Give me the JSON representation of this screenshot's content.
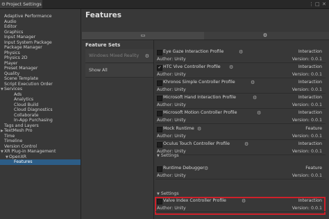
{
  "window": {
    "tab_label": "Project Settings",
    "icons": [
      "gear-icon",
      "more-icon",
      "maximize-icon",
      "close-icon"
    ],
    "controls": [
      "⋮",
      "□",
      "✕"
    ]
  },
  "sidebar": {
    "items": [
      {
        "label": "Adaptive Performance",
        "indent": 0
      },
      {
        "label": "Audio",
        "indent": 0
      },
      {
        "label": "Editor",
        "indent": 0
      },
      {
        "label": "Graphics",
        "indent": 0
      },
      {
        "label": "Input Manager",
        "indent": 0
      },
      {
        "label": "Input System Package",
        "indent": 0
      },
      {
        "label": "Package Manager",
        "indent": 0
      },
      {
        "label": "Physics",
        "indent": 0
      },
      {
        "label": "Physics 2D",
        "indent": 0
      },
      {
        "label": "Player",
        "indent": 0
      },
      {
        "label": "Preset Manager",
        "indent": 0
      },
      {
        "label": "Quality",
        "indent": 0
      },
      {
        "label": "Scene Template",
        "indent": 0
      },
      {
        "label": "Script Execution Order",
        "indent": 0
      },
      {
        "label": "Services",
        "indent": 0,
        "expanded": true
      },
      {
        "label": "Ads",
        "indent": 2
      },
      {
        "label": "Analytics",
        "indent": 2
      },
      {
        "label": "Cloud Build",
        "indent": 2
      },
      {
        "label": "Cloud Diagnostics",
        "indent": 2
      },
      {
        "label": "Collaborate",
        "indent": 2
      },
      {
        "label": "In-App Purchasing",
        "indent": 2
      },
      {
        "label": "Tags and Layers",
        "indent": 0
      },
      {
        "label": "TextMesh Pro",
        "indent": 0,
        "collapsed": true
      },
      {
        "label": "Time",
        "indent": 0
      },
      {
        "label": "Timeline",
        "indent": 0
      },
      {
        "label": "Version Control",
        "indent": 0
      },
      {
        "label": "XR Plug-in Management",
        "indent": 0,
        "expanded": true
      },
      {
        "label": "OpenXR",
        "indent": 1,
        "expanded": true
      },
      {
        "label": "Features",
        "indent": 2,
        "selected": true
      }
    ],
    "expanded_arrow": "▼",
    "collapsed_arrow": "▶"
  },
  "main": {
    "title": "Features",
    "platform_tabs": [
      {
        "icon": "monitor-icon",
        "glyph": "▭",
        "active": true
      },
      {
        "icon": "android-icon",
        "glyph": "⚙",
        "active": false
      }
    ],
    "feature_sets": {
      "header": "Feature Sets",
      "items": [
        {
          "label": "Windows Mixed Reality",
          "disabled": true,
          "has_gear": true
        },
        {
          "label": "Show All",
          "disabled": false,
          "has_gear": false
        }
      ]
    },
    "features": [
      {
        "name": "Eye Gaze Interaction Profile",
        "author": "Author: Unity",
        "category": "Interaction",
        "version": "Version: 0.0.1",
        "checked": false
      },
      {
        "name": "HTC Vive Controller Profile",
        "author": "Author: Unity",
        "category": "Interaction",
        "version": "Version: 0.0.1",
        "checked": true
      },
      {
        "name": "Khronos Simple Controller Profile",
        "author": "Author: Unity",
        "category": "Interaction",
        "version": "Version: 0.0.1",
        "checked": false
      },
      {
        "name": "Microsoft Hand Interaction Profile",
        "author": "Author: Unity",
        "category": "Interaction",
        "version": "Version: 0.0.1",
        "checked": false
      },
      {
        "name": "Microsoft Motion Controller Profile",
        "author": "Author: Unity",
        "category": "Interaction",
        "version": "Version: 0.0.1",
        "checked": false
      },
      {
        "name": "Mock Runtime",
        "author": "Author: Unity",
        "category": "Feature",
        "version": "Version: 0.0.1",
        "checked": false
      },
      {
        "name": "Oculus Touch Controller Profile",
        "author": "Author: Unity",
        "category": "Interaction",
        "version": "Version: 0.0.1",
        "checked": false
      },
      {
        "name": "Runtime Debugger",
        "author": "Author: Unity",
        "category": "Feature",
        "version": "Version: 0.0.1",
        "checked": false
      },
      {
        "name": "Valve Index Controller Profile",
        "author": "Author: Unity",
        "category": "Interaction",
        "version": "Version: 0.0.1",
        "checked": false,
        "highlighted": true
      }
    ],
    "settings_label": "Settings",
    "highlight_color": "#d0202a",
    "selection_color": "#2c5d87"
  }
}
